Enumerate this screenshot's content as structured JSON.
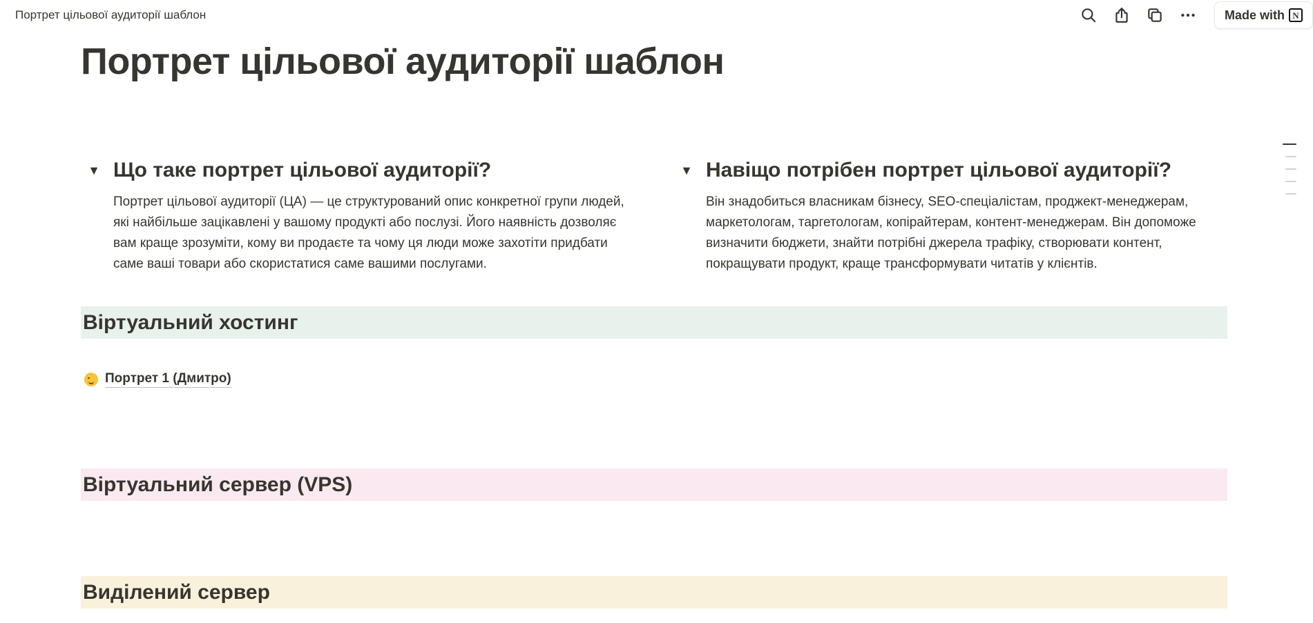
{
  "topbar": {
    "breadcrumb": "Портрет цільової аудиторії шаблон",
    "actions": [
      {
        "name": "search-icon"
      },
      {
        "name": "share-icon"
      },
      {
        "name": "duplicate-icon"
      },
      {
        "name": "more-icon"
      }
    ],
    "made_with_label": "Made with",
    "notion_logo_letter": "N"
  },
  "page": {
    "title": "Портрет цільової аудиторії шаблон"
  },
  "toggles": [
    {
      "title": "Що таке портрет цільової аудиторії?",
      "body": "Портрет цільової аудиторії (ЦА) — це структурований опис конкретної групи людей, які найбільше зацікавлені у вашому продукті або послузі. Його наявність дозволяє вам краще зрозуміти, кому ви продаєте та чому ця люди може захотіти придбати саме ваші товари або скористатися саме вашими послугами."
    },
    {
      "title": "Навіщо потрібен портрет цільової аудиторії?",
      "body": "Він знадобиться власникам бізнесу, SEO-спеціалістам, проджект-менеджерам, маркетологам, таргетологам, копірайтерам, контент-менеджерам. Він допоможе визначити бюджети, знайти потрібні джерела трафіку, створювати контент, покращувати продукт, краще трансформувати читатів у клієнтів."
    }
  ],
  "sections": {
    "virtual_hosting": "Віртуальний хостинг",
    "vps": "Віртуальний сервер (VPS)",
    "dedicated": "Виділений сервер"
  },
  "page_link": {
    "label": "Портрет 1 (Дмитро)",
    "icon": "winking-face-emoji"
  },
  "colors": {
    "text": "#37352f",
    "section_green": "#e8f1ec",
    "section_pink": "#fae9f0",
    "section_yellow": "#f9f1dc"
  }
}
